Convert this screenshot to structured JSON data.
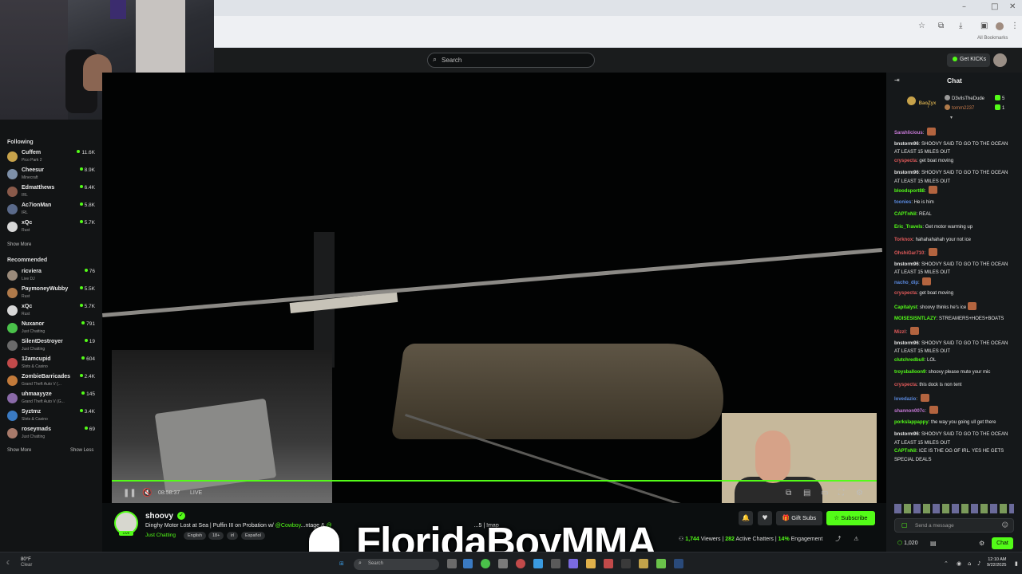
{
  "browser": {
    "bookmarks_label": "All Bookmarks"
  },
  "header": {
    "search_placeholder": "Search",
    "get_kicks_label": "Get KICKs"
  },
  "sidebar": {
    "following_title": "Following",
    "following": [
      {
        "name": "Cuffem",
        "category": "Pico Park 2",
        "viewers": "11.6K",
        "color": "#c7a24a"
      },
      {
        "name": "Cheesur",
        "category": "Minecraft",
        "viewers": "8.9K",
        "color": "#7d8fa8"
      },
      {
        "name": "Edmatthews",
        "category": "IRL",
        "viewers": "6.4K",
        "color": "#8a5a4a"
      },
      {
        "name": "Ac7ionMan",
        "category": "IRL",
        "viewers": "5.8K",
        "color": "#5a6a8a"
      },
      {
        "name": "xQc",
        "category": "Rust",
        "viewers": "5.7K",
        "color": "#d7d7d7"
      }
    ],
    "show_more_1": "Show More",
    "recommended_title": "Recommended",
    "recommended": [
      {
        "name": "ricviera",
        "category": "Live DJ",
        "viewers": "76",
        "color": "#9a8a7a"
      },
      {
        "name": "PaymoneyWubby",
        "category": "Rust",
        "viewers": "5.5K",
        "color": "#b07a4a"
      },
      {
        "name": "xQc",
        "category": "Rust",
        "viewers": "5.7K",
        "color": "#d7d7d7"
      },
      {
        "name": "Nuxanor",
        "category": "Just Chatting",
        "viewers": "791",
        "color": "#4ac24a"
      },
      {
        "name": "SilentDestroyer",
        "category": "Just Chatting",
        "viewers": "19",
        "color": "#6a6a6a"
      },
      {
        "name": "12amcupid",
        "category": "Slots & Casino",
        "viewers": "604",
        "color": "#c24a4a"
      },
      {
        "name": "ZombieBarricades",
        "category": "Grand Theft Auto V (...",
        "viewers": "2.4K",
        "color": "#c27a3a"
      },
      {
        "name": "uhmaayyze",
        "category": "Grand Theft Auto V (G...",
        "viewers": "145",
        "color": "#8a6aa8"
      },
      {
        "name": "Syztmz",
        "category": "Slots & Casino",
        "viewers": "3.4K",
        "color": "#3a7ac2"
      },
      {
        "name": "roseymads",
        "category": "Just Chatting",
        "viewers": "69",
        "color": "#a87a6a"
      }
    ],
    "show_more_2": "Show More",
    "show_less": "Show Less"
  },
  "player": {
    "time": "08:58:37",
    "live_label": "LIVE"
  },
  "stream": {
    "streamer": "shoovy",
    "live_badge": "LIVE",
    "title_prefix": "Dinghy Motor Lost at Sea | Puffin III on Probation w/",
    "title_mention1": "@Cowboy",
    "title_mid": "...ntage &",
    "title_mention2": "@",
    "title_suffix": "...5 | !map",
    "category": "Just Chatting",
    "tags": [
      "English",
      "18+",
      "irl",
      "Español"
    ],
    "gift_subs_label": "Gift Subs",
    "subscribe_label": "Subscribe",
    "viewers": "1,744",
    "viewers_label": "Viewers",
    "active_chatters": "282",
    "active_label": "Active Chatters",
    "engagement": "14%",
    "engagement_label": "Engagement",
    "watermark": "FloridaBoyMMA"
  },
  "chat": {
    "title": "Chat",
    "leaderboard": [
      {
        "name": "BaoZyx",
        "count": "7"
      },
      {
        "name": "D3vilsTheDude",
        "count": "5"
      },
      {
        "name": "tomm2237",
        "count": "1"
      }
    ],
    "messages": [
      {
        "user": "Sarahlicious",
        "text": "",
        "color": "#c77ad7",
        "emote": true
      },
      {
        "user": "bnstorm96",
        "text": "SHOOVY SAID TO GO TO THE OCEAN AT LEAST 15 MILES OUT",
        "color": "#e6e6e6"
      },
      {
        "user": "cryspecta",
        "text": "get boat moving",
        "color": "#e05a5a"
      },
      {
        "user": "bnstorm96",
        "text": "SHOOVY SAID TO GO TO THE OCEAN AT LEAST 15 MILES OUT",
        "color": "#e6e6e6"
      },
      {
        "user": "bloodsport88",
        "text": "",
        "color": "#53fc18",
        "emote": true
      },
      {
        "user": "toonies",
        "text": "He is him",
        "color": "#5a8ae0"
      },
      {
        "user": "CAPTnNil",
        "text": "REAL",
        "color": "#53fc18"
      },
      {
        "user": "Eric_Travels",
        "text": "Get motor warming up",
        "color": "#53fc18"
      },
      {
        "user": "Torknox",
        "text": "hahahahahah your not ice",
        "color": "#e05a5a"
      },
      {
        "user": "OhshiGar710",
        "text": "",
        "color": "#e05a5a",
        "emote": true
      },
      {
        "user": "bnstorm96",
        "text": "SHOOVY SAID TO GO TO THE OCEAN AT LEAST 15 MILES OUT",
        "color": "#e6e6e6"
      },
      {
        "user": "nacho_dip",
        "text": "",
        "color": "#5a8ae0",
        "emote": true
      },
      {
        "user": "cryspecta",
        "text": "get boat moving",
        "color": "#e05a5a"
      },
      {
        "user": "Capitalyst",
        "text": "shoovy thinks he's ice",
        "color": "#53fc18",
        "emote": true
      },
      {
        "user": "MOISESISNTLAZY",
        "text": "STREAMERS+HOES+BOATS",
        "color": "#53fc18"
      },
      {
        "user": "Mizzl",
        "text": "",
        "color": "#e05a5a",
        "emote": true
      },
      {
        "user": "bnstorm96",
        "text": "SHOOVY SAID TO GO TO THE OCEAN AT LEAST 15 MILES OUT",
        "color": "#e6e6e6"
      },
      {
        "user": "clutchredbull",
        "text": "LOL",
        "color": "#53fc18"
      },
      {
        "user": "troysballoon9",
        "text": "shoovy please mute your mic",
        "color": "#53fc18"
      },
      {
        "user": "cryspecta",
        "text": "this dock is non tent",
        "color": "#e05a5a"
      },
      {
        "user": "lovedazio",
        "text": "",
        "color": "#5a8ae0",
        "emote": true
      },
      {
        "user": "shannon007c",
        "text": "",
        "color": "#c77ad7",
        "emote": true
      },
      {
        "user": "porkslappappy",
        "text": "the way you going ull get there",
        "color": "#53fc18"
      },
      {
        "user": "bnstorm96",
        "text": "SHOOVY SAID TO GO TO THE OCEAN AT LEAST 15 MILES OUT",
        "color": "#e6e6e6"
      },
      {
        "user": "CAPTnNil",
        "text": "ICE IS THE OG OF IRL. YES HE GETS SPECIAL DEALS",
        "color": "#53fc18"
      }
    ],
    "input_placeholder": "Send a message",
    "kicks_count": "1,020",
    "chat_button": "Chat"
  },
  "taskbar": {
    "temperature": "80°F",
    "weather": "Clear",
    "search_placeholder": "Search",
    "time": "12:10 AM",
    "date": "9/22/2025"
  }
}
